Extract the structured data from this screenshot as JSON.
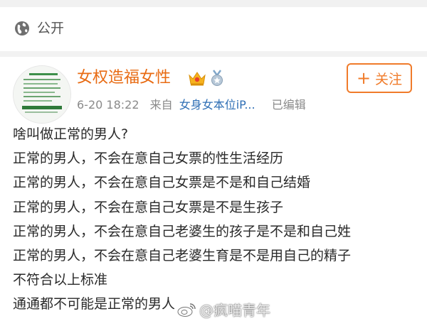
{
  "header": {
    "visibility_icon": "globe-icon",
    "visibility_label": "公开"
  },
  "post": {
    "author": {
      "name": "女权造福女性",
      "badges": [
        "vip-crown-icon",
        "medal-icon"
      ]
    },
    "follow_button": {
      "label": "关注",
      "icon": "plus-icon",
      "color": "#f07b2a"
    },
    "meta": {
      "timestamp": "6-20 18:22",
      "source_prefix": "来自",
      "source": "女身女本位iP...",
      "edited": "已编辑"
    },
    "lines": [
      "啥叫做正常的男人?",
      "正常的男人，不会在意自己女票的性生活经历",
      "正常的男人，不会在意自己女票是不是和自己结婚",
      "正常的男人，不会在意自己女票是不是生孩子",
      "正常的男人，不会在意自己老婆生的孩子是不是和自己姓",
      "正常的男人，不会在意自己老婆生育是不是用自己的精子",
      "不符合以上标准",
      "通通都不可能是正常的男人"
    ]
  },
  "watermark": {
    "icon": "weibo-logo-icon",
    "text": "@疯喵青年"
  },
  "colors": {
    "author_name": "#e86b13",
    "source_link": "#2f6fb5",
    "meta_text": "#8a8a8a",
    "body_text": "#2a2a2a"
  }
}
